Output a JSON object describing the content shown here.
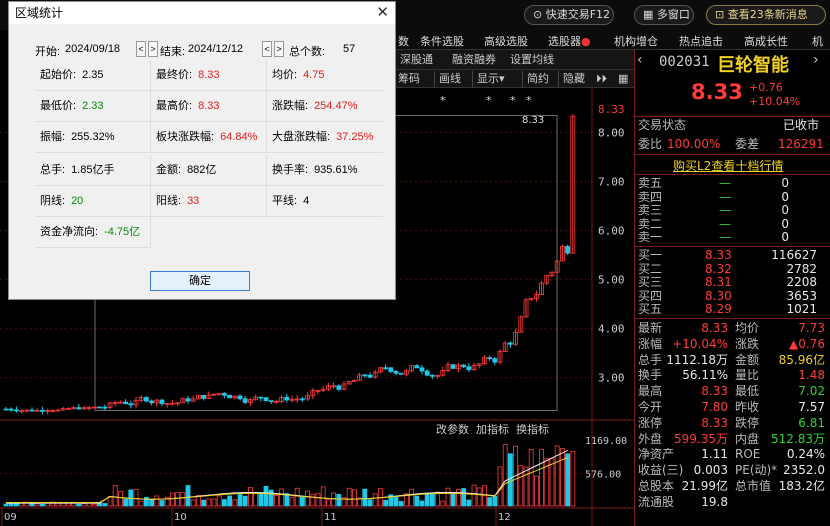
{
  "topbar": {
    "fast_trade": "快速交易F12",
    "multi_window": "多窗口",
    "news": "查看23条新消息"
  },
  "menu": [
    "数",
    "条件选股",
    "高级选股",
    "选股器",
    "机构增仓",
    "热点追击",
    "高成长性",
    "机"
  ],
  "subtabs": [
    "深股通",
    "融资融券",
    "设置均线",
    "筹码",
    "画线",
    "显示",
    "简约",
    "隐藏"
  ],
  "chart": {
    "price_labels": [
      "8.33",
      "8.00",
      "7.00",
      "6.00",
      "5.00",
      "4.00",
      "3.00"
    ],
    "last_price_tag": "8.33",
    "vol_labels": [
      "1169.00",
      "576.00"
    ],
    "vol_tabs": [
      "改参数",
      "加指标",
      "换指标"
    ],
    "date_labels": [
      "09",
      "10",
      "11",
      "12"
    ]
  },
  "chart_data": {
    "type": "candlestick",
    "x_labels": [
      "09",
      "10",
      "11",
      "12"
    ],
    "ylim": [
      2.3,
      8.5
    ],
    "close_last": 8.33,
    "volume_ylim": [
      0,
      1169
    ]
  },
  "quote": {
    "code": "002031",
    "name": "巨轮智能",
    "price": "8.33",
    "change": "+0.76",
    "change_pct": "+10.04%",
    "trade_status_label": "交易状态",
    "trade_status": "已收市",
    "weibi_label": "委比",
    "weibi": "100.00%",
    "weicha_label": "委差",
    "weicha": "126291",
    "buy_l2": "购买L2查看十档行情",
    "asks": [
      {
        "label": "卖五",
        "price": "—",
        "vol": "0"
      },
      {
        "label": "卖四",
        "price": "—",
        "vol": "0"
      },
      {
        "label": "卖三",
        "price": "—",
        "vol": "0"
      },
      {
        "label": "卖二",
        "price": "—",
        "vol": "0"
      },
      {
        "label": "卖一",
        "price": "—",
        "vol": "0"
      }
    ],
    "bids": [
      {
        "label": "买一",
        "price": "8.33",
        "vol": "116627"
      },
      {
        "label": "买二",
        "price": "8.32",
        "vol": "2782"
      },
      {
        "label": "买三",
        "price": "8.31",
        "vol": "2208"
      },
      {
        "label": "买四",
        "price": "8.30",
        "vol": "3653"
      },
      {
        "label": "买五",
        "price": "8.29",
        "vol": "1021"
      }
    ],
    "stats": [
      {
        "l1": "最新",
        "v1": "8.33",
        "c1": "red",
        "l2": "均价",
        "v2": "7.73",
        "c2": "red"
      },
      {
        "l1": "涨幅",
        "v1": "+10.04%",
        "c1": "red",
        "l2": "涨跌",
        "v2": "▲0.76",
        "c2": "red"
      },
      {
        "l1": "总手",
        "v1": "1112.18万",
        "c1": "white",
        "l2": "金额",
        "v2": "85.96亿",
        "c2": "yellow"
      },
      {
        "l1": "换手",
        "v1": "56.11%",
        "c1": "white",
        "l2": "量比",
        "v2": "1.48",
        "c2": "red"
      },
      {
        "l1": "最高",
        "v1": "8.33",
        "c1": "red",
        "l2": "最低",
        "v2": "7.02",
        "c2": "green"
      },
      {
        "l1": "今开",
        "v1": "7.80",
        "c1": "red",
        "l2": "昨收",
        "v2": "7.57",
        "c2": "white"
      },
      {
        "l1": "涨停",
        "v1": "8.33",
        "c1": "red",
        "l2": "跌停",
        "v2": "6.81",
        "c2": "green"
      },
      {
        "l1": "外盘",
        "v1": "599.35万",
        "c1": "red",
        "l2": "内盘",
        "v2": "512.83万",
        "c2": "green"
      },
      {
        "l1": "净资产",
        "v1": "1.11",
        "c1": "white",
        "l2": "ROE",
        "v2": "0.24%",
        "c2": "white"
      },
      {
        "l1": "收益(三)",
        "v1": "0.003",
        "c1": "white",
        "l2": "PE(动)*",
        "v2": "2352.0",
        "c2": "white"
      },
      {
        "l1": "总股本",
        "v1": "21.99亿",
        "c1": "white",
        "l2": "总市值",
        "v2": "183.2亿",
        "c2": "white"
      },
      {
        "l1": "流通股",
        "v1": "19.8",
        "c1": "white",
        "l2": "",
        "v2": "",
        "c2": "white"
      }
    ]
  },
  "dialog": {
    "title": "区域统计",
    "start_label": "开始:",
    "start": "2024/09/18",
    "end_label": "结束:",
    "end": "2024/12/12",
    "count_label": "总个数:",
    "count": "57",
    "cells": [
      {
        "label": "起始价:",
        "value": "2.35",
        "color": "black"
      },
      {
        "label": "最终价:",
        "value": "8.33",
        "color": "red"
      },
      {
        "label": "均价:",
        "value": "4.75",
        "color": "red"
      },
      {
        "label": "最低价:",
        "value": "2.33",
        "color": "green"
      },
      {
        "label": "最高价:",
        "value": "8.33",
        "color": "red"
      },
      {
        "label": "涨跌幅:",
        "value": "254.47%",
        "color": "red"
      },
      {
        "label": "振幅:",
        "value": "255.32%",
        "color": "black"
      },
      {
        "label": "板块涨跌幅:",
        "value": "64.84%",
        "color": "red"
      },
      {
        "label": "大盘涨跌幅:",
        "value": "37.25%",
        "color": "red"
      },
      {
        "label": "总手:",
        "value": "1.85亿手",
        "color": "black"
      },
      {
        "label": "金额:",
        "value": "882亿",
        "color": "black"
      },
      {
        "label": "换手率:",
        "value": "935.61%",
        "color": "black"
      },
      {
        "label": "阴线:",
        "value": "20",
        "color": "green"
      },
      {
        "label": "阳线:",
        "value": "33",
        "color": "red"
      },
      {
        "label": "平线:",
        "value": "4",
        "color": "black"
      },
      {
        "label": "资金净流向:",
        "value": "-4.75亿",
        "color": "green"
      }
    ],
    "ok": "确定"
  }
}
